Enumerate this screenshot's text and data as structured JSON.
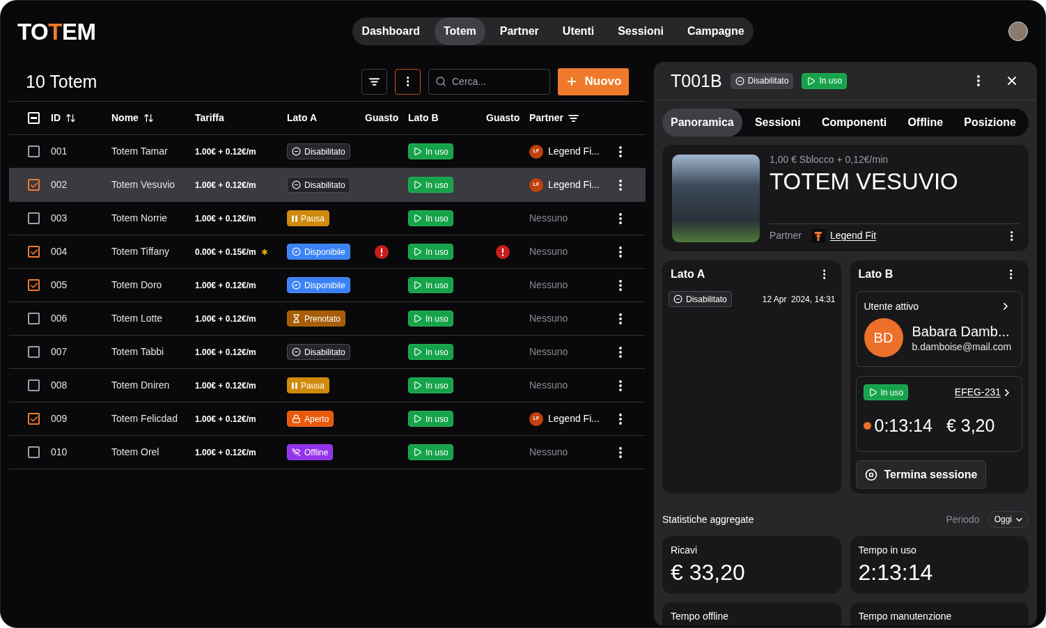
{
  "logo": {
    "parts": [
      {
        "text": "TO",
        "accent": false
      },
      {
        "text": "T",
        "accent": true
      },
      {
        "text": "EM",
        "accent": false
      }
    ]
  },
  "nav": [
    {
      "label": "Dashboard",
      "selected": false
    },
    {
      "label": "Totem",
      "selected": true
    },
    {
      "label": "Partner",
      "selected": false
    },
    {
      "label": "Utenti",
      "selected": false
    },
    {
      "label": "Sessioni",
      "selected": false
    },
    {
      "label": "Campagne",
      "selected": false
    }
  ],
  "list": {
    "title": "10 Totem",
    "search": {
      "placeholder": "Cerca..."
    },
    "new_button": "Nuovo",
    "select_all": {
      "indeterminate": true
    },
    "columns": [
      {
        "label": "ID",
        "sortable": true,
        "filterable": false
      },
      {
        "label": "Nome",
        "sortable": true,
        "filterable": false
      },
      {
        "label": "Tariffa",
        "sortable": false,
        "filterable": false
      },
      {
        "label": "Lato A",
        "sortable": false,
        "filterable": false
      },
      {
        "label": "Guasto",
        "sortable": false,
        "filterable": false
      },
      {
        "label": "Lato B",
        "sortable": false,
        "filterable": false
      },
      {
        "label": "Guasto",
        "sortable": false,
        "filterable": false
      },
      {
        "label": "Partner",
        "sortable": false,
        "filterable": true
      }
    ],
    "rows": [
      {
        "checked": false,
        "selected": false,
        "id": "001",
        "name": "Totem Tamar",
        "rate": "1.00€ + 0.12€/m",
        "rate_flag": false,
        "side_a": {
          "kind": "disabled",
          "label": "Disabilitato"
        },
        "fault_a": false,
        "side_b": {
          "kind": "in_use",
          "label": "In uso"
        },
        "fault_b": false,
        "partner": {
          "kind": "partner",
          "initials": "LF",
          "name": "Legend Fi..."
        }
      },
      {
        "checked": true,
        "selected": true,
        "id": "002",
        "name": "Totem Vesuvio",
        "rate": "1.00€ + 0.12€/m",
        "rate_flag": false,
        "side_a": {
          "kind": "disabled",
          "label": "Disabilitato"
        },
        "fault_a": false,
        "side_b": {
          "kind": "in_use",
          "label": "In uso"
        },
        "fault_b": false,
        "partner": {
          "kind": "partner",
          "initials": "LF",
          "name": "Legend Fi..."
        }
      },
      {
        "checked": false,
        "selected": false,
        "id": "003",
        "name": "Totem Norrie",
        "rate": "1.00€ + 0.12€/m",
        "rate_flag": false,
        "side_a": {
          "kind": "pause",
          "label": "Pausa"
        },
        "fault_a": false,
        "side_b": {
          "kind": "in_use",
          "label": "In uso"
        },
        "fault_b": false,
        "partner": {
          "kind": "none",
          "name": "Nessuno"
        }
      },
      {
        "checked": true,
        "selected": false,
        "id": "004",
        "name": "Totem Tiffany",
        "rate": "0.00€ + 0.15€/m",
        "rate_flag": true,
        "side_a": {
          "kind": "available",
          "label": "Disponibile"
        },
        "fault_a": true,
        "side_b": {
          "kind": "in_use",
          "label": "In uso"
        },
        "fault_b": true,
        "partner": {
          "kind": "none",
          "name": "Nessuno"
        }
      },
      {
        "checked": true,
        "selected": false,
        "id": "005",
        "name": "Totem Doro",
        "rate": "1.00€ + 0.12€/m",
        "rate_flag": false,
        "side_a": {
          "kind": "available",
          "label": "Disponibile"
        },
        "fault_a": false,
        "side_b": {
          "kind": "in_use",
          "label": "In uso"
        },
        "fault_b": false,
        "partner": {
          "kind": "none",
          "name": "Nessuno"
        }
      },
      {
        "checked": false,
        "selected": false,
        "id": "006",
        "name": "Totem Lotte",
        "rate": "1.00€ + 0.12€/m",
        "rate_flag": false,
        "side_a": {
          "kind": "booked",
          "label": "Prenotato"
        },
        "fault_a": false,
        "side_b": {
          "kind": "in_use",
          "label": "In uso"
        },
        "fault_b": false,
        "partner": {
          "kind": "none",
          "name": "Nessuno"
        }
      },
      {
        "checked": false,
        "selected": false,
        "id": "007",
        "name": "Totem Tabbi",
        "rate": "1.00€ + 0.12€/m",
        "rate_flag": false,
        "side_a": {
          "kind": "disabled",
          "label": "Disabilitato"
        },
        "fault_a": false,
        "side_b": {
          "kind": "in_use",
          "label": "In uso"
        },
        "fault_b": false,
        "partner": {
          "kind": "none",
          "name": "Nessuno"
        }
      },
      {
        "checked": false,
        "selected": false,
        "id": "008",
        "name": "Totem Dniren",
        "rate": "1.00€ + 0.12€/m",
        "rate_flag": false,
        "side_a": {
          "kind": "pause",
          "label": "Pausa"
        },
        "fault_a": false,
        "side_b": {
          "kind": "in_use",
          "label": "In uso"
        },
        "fault_b": false,
        "partner": {
          "kind": "none",
          "name": "Nessuno"
        }
      },
      {
        "checked": true,
        "selected": false,
        "id": "009",
        "name": "Totem Felicdad",
        "rate": "1.00€ + 0.12€/m",
        "rate_flag": false,
        "side_a": {
          "kind": "open",
          "label": "Aperto"
        },
        "fault_a": false,
        "side_b": {
          "kind": "in_use",
          "label": "In uso"
        },
        "fault_b": false,
        "partner": {
          "kind": "partner",
          "initials": "LF",
          "name": "Legend Fi..."
        }
      },
      {
        "checked": false,
        "selected": false,
        "id": "010",
        "name": "Totem Orel",
        "rate": "1.00€ + 0.12€/m",
        "rate_flag": false,
        "side_a": {
          "kind": "offline",
          "label": "Offline"
        },
        "fault_a": false,
        "side_b": {
          "kind": "in_use",
          "label": "In uso"
        },
        "fault_b": false,
        "partner": {
          "kind": "none",
          "name": "Nessuno"
        }
      }
    ]
  },
  "detail": {
    "title": "T001B",
    "badges": [
      {
        "kind": "disabled",
        "label": "Disabilitato"
      },
      {
        "kind": "in_use",
        "label": "In uso"
      }
    ],
    "tabs": [
      {
        "label": "Panoramica",
        "selected": true
      },
      {
        "label": "Sessioni",
        "selected": false
      },
      {
        "label": "Componenti",
        "selected": false
      },
      {
        "label": "Offline",
        "selected": false
      },
      {
        "label": "Posizione",
        "selected": false
      }
    ],
    "summary": {
      "rate": "1,00 € Sblocco + 0,12€/min",
      "name": "TOTEM VESUVIO",
      "partner_label": "Partner",
      "partner_name": "Legend Fit"
    },
    "side_a": {
      "title": "Lato A",
      "status": {
        "kind": "disabled",
        "label": "Disabilitato"
      },
      "date": "12 Apr  2024, 14:31"
    },
    "side_b": {
      "title": "Lato B",
      "active_user": {
        "heading": "Utente attivo",
        "initials": "BD",
        "name": "Babara Damb...",
        "email": "b.damboise@mail.com"
      },
      "session": {
        "status": {
          "kind": "in_use",
          "label": "In uso"
        },
        "code": "EFEG-231",
        "time": "0:13:14",
        "amount": "€ 3,20"
      },
      "end_button": "Termina sessione"
    },
    "stats": {
      "title": "Statistiche aggregate",
      "period_label": "Periodo",
      "period_value": "Oggi",
      "cards": [
        {
          "label": "Ricavi",
          "value": "€ 33,20"
        },
        {
          "label": "Tempo in uso",
          "value": "2:13:14"
        },
        {
          "label": "Tempo offline"
        },
        {
          "label": "Tempo manutenzione"
        }
      ]
    }
  }
}
